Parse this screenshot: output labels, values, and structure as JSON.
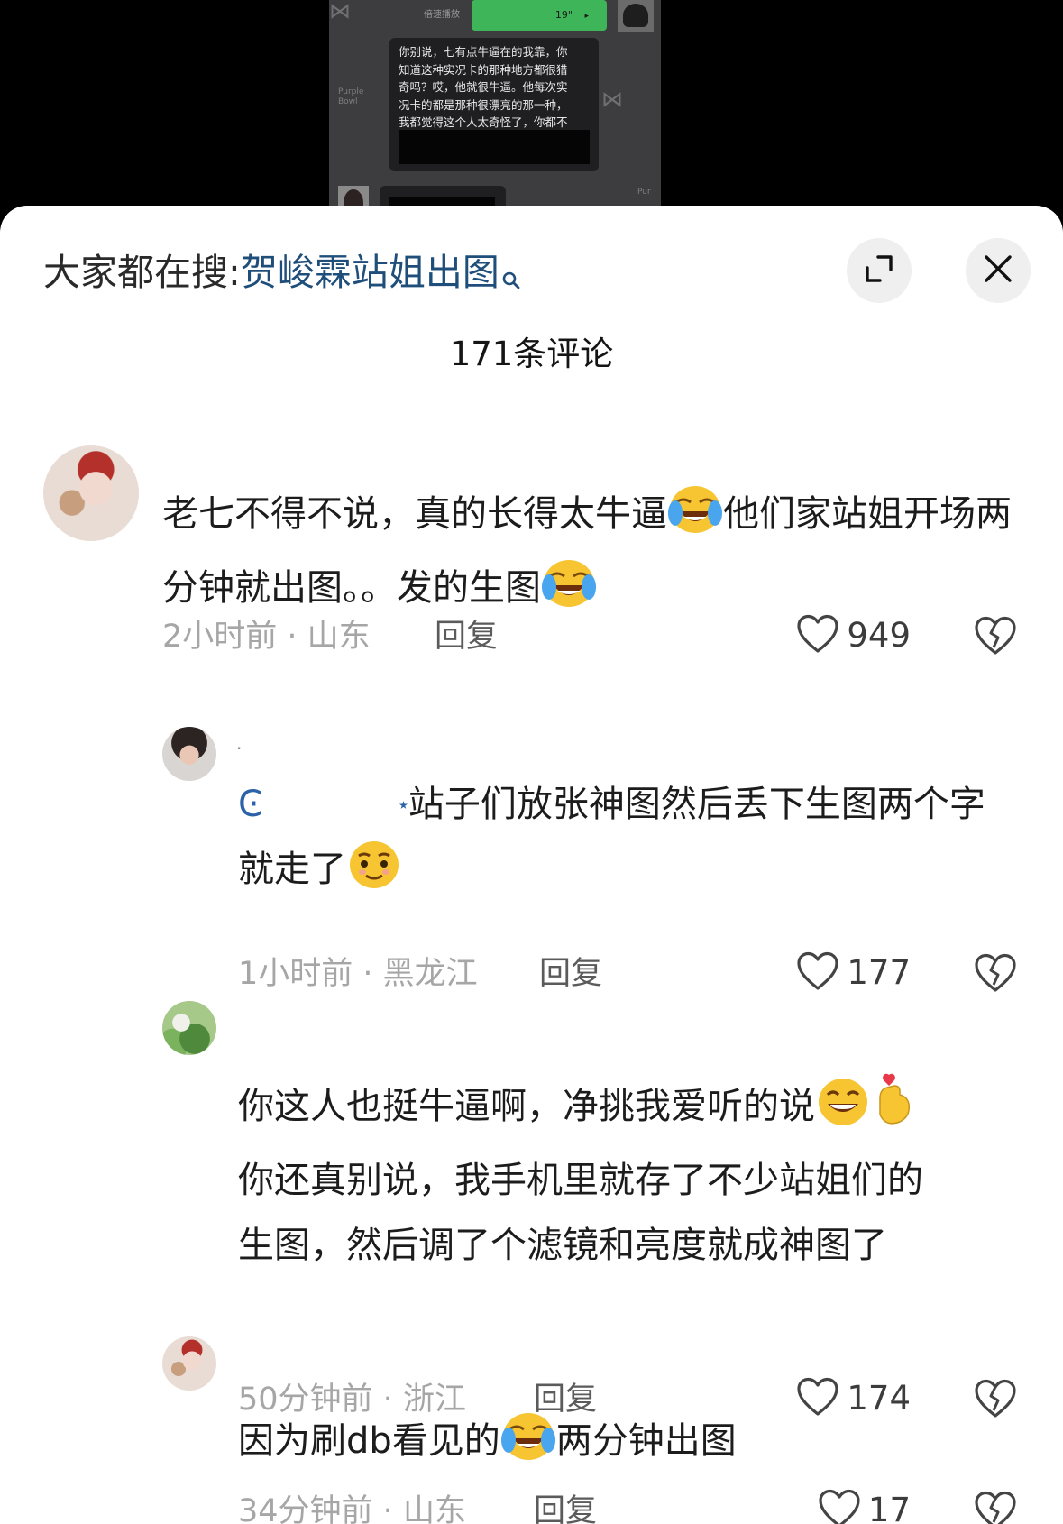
{
  "video": {
    "speed_label": "倍速播放",
    "voice_duration": "19\"",
    "bubble_lines": [
      "你别说，七有点牛逼在的我靠，你",
      "知道这种实况卡的那种地方都很猎",
      "奇吗？哎，他就很牛逼。他每次实",
      "况卡的都是那种很漂亮的那一种，",
      "我都觉得这个人太奇怪了，你都不"
    ],
    "watermark_left": "Purple\nBowl",
    "watermark_right": "Pur"
  },
  "header": {
    "search_prefix": "大家都在搜:",
    "search_keyword": "贺峻霖站姐出图",
    "comment_count": "171条评论"
  },
  "comments": [
    {
      "avatar": "pig-avatar",
      "text_parts": [
        "老七不得不说，真的长得太牛逼",
        "他们家站姐开场两分钟就出图。。发的生图"
      ],
      "time": "2小时前",
      "location": "山东",
      "reply_label": "回复",
      "likes": "949"
    },
    {
      "avatar": "woman-avatar",
      "username": "·",
      "mention": "Ͼ",
      "text_parts": [
        "站子们放张神图然后丢下生图两个字就走了"
      ],
      "time": "1小时前",
      "location": "黑龙江",
      "reply_label": "回复",
      "likes": "177"
    },
    {
      "avatar": "plant-avatar",
      "text_parts": [
        "你这人也挺牛逼啊，净挑我爱听的说",
        "你还真别说，我手机里就存了不少站姐们的",
        "生图，然后调了个滤镜和亮度就成神图了"
      ],
      "time": "50分钟前",
      "location": "浙江",
      "reply_label": "回复",
      "likes": "174"
    },
    {
      "avatar": "pig-avatar",
      "text_parts": [
        "因为刷db看见的",
        "两分钟出图"
      ],
      "time": "34分钟前",
      "location": "山东",
      "reply_label": "回复",
      "likes": "17"
    }
  ],
  "colors": {
    "keyword": "#1f4e7a",
    "meta": "#a6a6a6",
    "voice_bubble": "#3fb55a"
  }
}
